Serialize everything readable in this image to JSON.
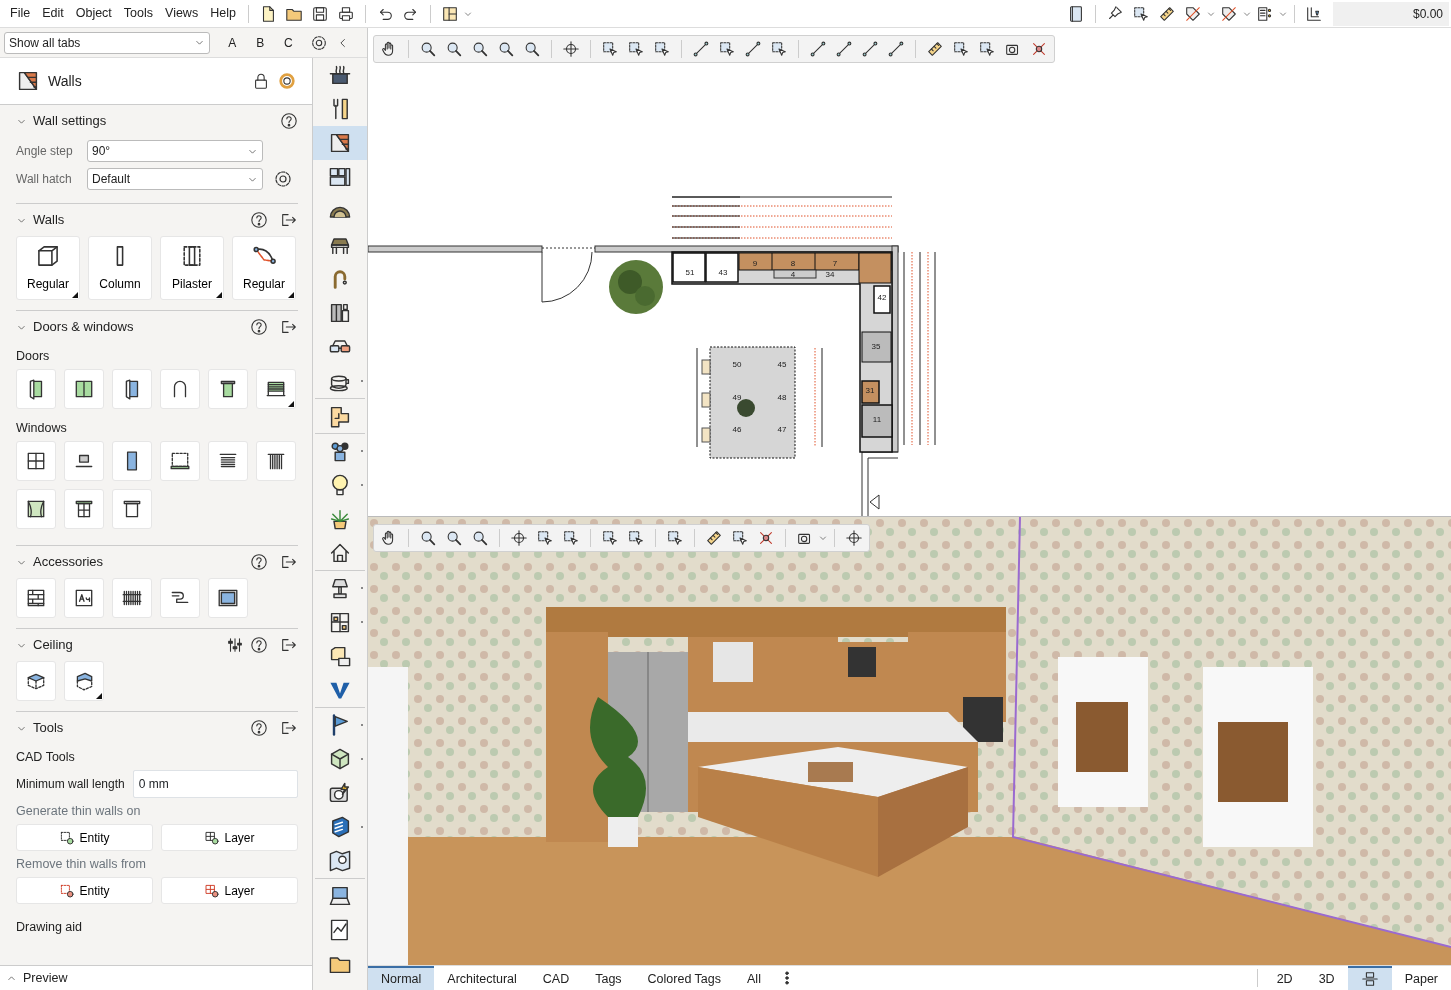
{
  "menu": [
    "File",
    "Edit",
    "Object",
    "Tools",
    "Views",
    "Help"
  ],
  "cost": "$0.00",
  "tab_filter": {
    "value": "Show all tabs"
  },
  "filter_buttons": [
    "A",
    "B",
    "C"
  ],
  "panel": {
    "title": "Walls",
    "sections": [
      {
        "kind": "fields",
        "title": "Wall settings",
        "expanded": true,
        "has_export": false,
        "has_adjust": false,
        "fields": [
          {
            "label": "Angle step",
            "value": "90°"
          },
          {
            "label": "Wall hatch",
            "value": "Default"
          }
        ]
      },
      {
        "kind": "tiles",
        "title": "Walls",
        "expanded": true,
        "has_export": true,
        "has_adjust": false,
        "tiles": [
          {
            "label": "Regular",
            "has_menu": true
          },
          {
            "label": "Column",
            "has_menu": false
          },
          {
            "label": "Pilaster",
            "has_menu": true
          },
          {
            "label": "Regular",
            "has_menu": true
          }
        ]
      },
      {
        "kind": "groups",
        "title": "Doors & windows",
        "expanded": true,
        "has_export": true,
        "has_adjust": false,
        "groups": [
          {
            "title": "Doors",
            "tiles": [
              {
                "has_menu": false
              },
              {
                "has_menu": false
              },
              {
                "has_menu": false
              },
              {
                "has_menu": false
              },
              {
                "has_menu": false
              },
              {
                "has_menu": true
              }
            ]
          },
          {
            "title": "Windows",
            "tiles": [
              {
                "has_menu": false
              },
              {
                "has_menu": false
              },
              {
                "has_menu": false
              },
              {
                "has_menu": false
              },
              {
                "has_menu": false
              },
              {
                "has_menu": false
              },
              {
                "has_menu": false
              },
              {
                "has_menu": false
              },
              {
                "has_menu": false
              }
            ]
          }
        ]
      },
      {
        "kind": "tiles",
        "title": "Accessories",
        "expanded": true,
        "has_export": true,
        "has_adjust": false,
        "tiles": [
          {
            "has_menu": false
          },
          {
            "has_menu": false
          },
          {
            "has_menu": false
          },
          {
            "has_menu": false
          },
          {
            "has_menu": false
          }
        ]
      },
      {
        "kind": "tiles",
        "title": "Ceiling",
        "expanded": true,
        "has_export": true,
        "has_adjust": true,
        "tiles": [
          {
            "has_menu": false
          },
          {
            "has_menu": true
          }
        ]
      },
      {
        "kind": "tools",
        "title": "Tools",
        "expanded": true,
        "has_export": true,
        "has_adjust": false,
        "subtitle": "CAD Tools",
        "field": {
          "label": "Minimum wall length",
          "value": "0 mm"
        },
        "actions": [
          {
            "title": "Generate thin walls on",
            "buttons": [
              "Entity",
              "Layer"
            ]
          },
          {
            "title": "Remove thin walls from",
            "buttons": [
              "Entity",
              "Layer"
            ]
          }
        ],
        "footer_title": "Drawing aid"
      }
    ],
    "footer": {
      "label": "Preview",
      "expanded": false
    }
  },
  "side_tools": [
    {
      "selected": false,
      "has_more": false
    },
    {
      "selected": false,
      "has_more": false
    },
    {
      "selected": true,
      "has_more": false
    },
    {
      "selected": false,
      "has_more": false
    },
    {
      "selected": false,
      "has_more": false
    },
    {
      "selected": false,
      "has_more": false
    },
    {
      "selected": false,
      "has_more": false
    },
    {
      "selected": false,
      "has_more": false
    },
    {
      "selected": false,
      "has_more": false
    },
    {
      "selected": false,
      "has_more": true
    },
    {
      "selected": false,
      "has_more": false
    },
    {
      "selected": false,
      "has_more": true
    },
    {
      "selected": false,
      "has_more": true
    },
    {
      "selected": false,
      "has_more": false
    },
    {
      "selected": false,
      "has_more": false
    },
    {
      "selected": false,
      "has_more": true
    },
    {
      "selected": false,
      "has_more": true
    },
    {
      "selected": false,
      "has_more": false
    },
    {
      "selected": false,
      "has_more": false
    },
    {
      "selected": false,
      "has_more": true
    },
    {
      "selected": false,
      "has_more": true
    },
    {
      "selected": false,
      "has_more": false
    },
    {
      "selected": false,
      "has_more": true
    },
    {
      "selected": false,
      "has_more": false
    },
    {
      "selected": false,
      "has_more": false
    },
    {
      "selected": false,
      "has_more": false
    },
    {
      "selected": false,
      "has_more": false
    }
  ],
  "plan": {
    "labels": [
      "51",
      "43",
      "9",
      "8",
      "7",
      "4",
      "34",
      "42",
      "35",
      "31",
      "11",
      "50",
      "45",
      "49",
      "48",
      "46",
      "47"
    ]
  },
  "view_tabs": [
    {
      "label": "Normal",
      "selected": true
    },
    {
      "label": "Architectural",
      "selected": false
    },
    {
      "label": "CAD",
      "selected": false
    },
    {
      "label": "Tags",
      "selected": false
    },
    {
      "label": "Colored Tags",
      "selected": false
    },
    {
      "label": "All",
      "selected": false
    }
  ],
  "view_switch": [
    {
      "kind": "text",
      "label": "2D",
      "selected": false
    },
    {
      "kind": "text",
      "label": "3D",
      "selected": false
    },
    {
      "kind": "icon",
      "selected": true
    },
    {
      "kind": "text",
      "label": "Paper",
      "selected": false
    }
  ]
}
